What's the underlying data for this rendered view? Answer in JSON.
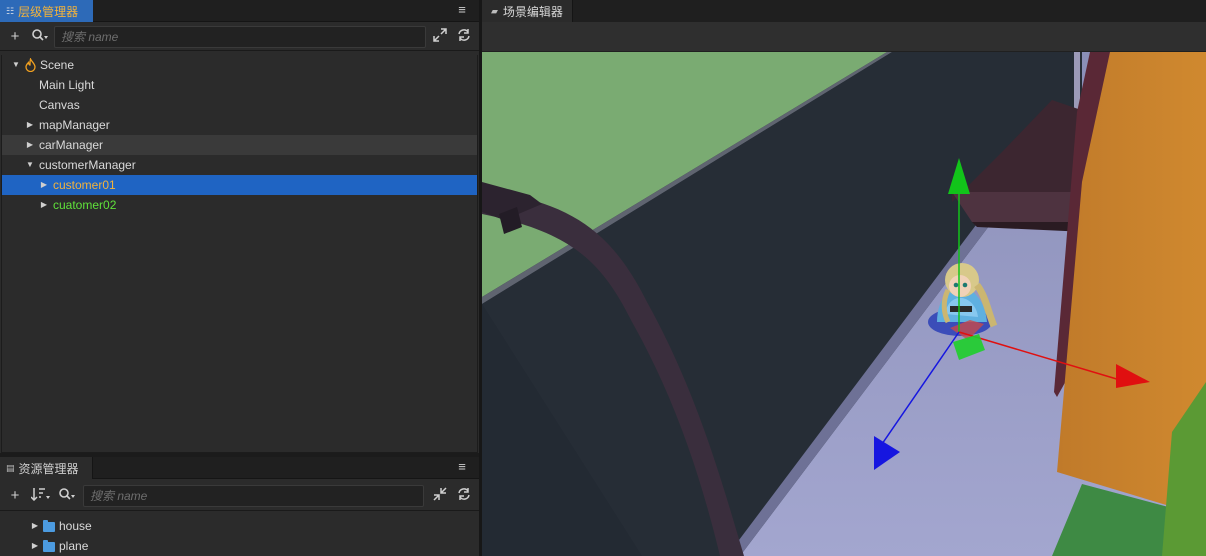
{
  "hierarchy_panel": {
    "tab_label": "层级管理器",
    "search_placeholder": "搜索 name",
    "tree": [
      {
        "label": "Scene",
        "depth": 0,
        "expanded": true,
        "has_children": true,
        "state": "normal"
      },
      {
        "label": "Main Light",
        "depth": 1,
        "has_children": false,
        "state": "normal"
      },
      {
        "label": "Canvas",
        "depth": 1,
        "has_children": false,
        "state": "normal"
      },
      {
        "label": "mapManager",
        "depth": 1,
        "expanded": false,
        "has_children": true,
        "state": "normal"
      },
      {
        "label": "carManager",
        "depth": 1,
        "expanded": false,
        "has_children": true,
        "state": "hover"
      },
      {
        "label": "customerManager",
        "depth": 1,
        "expanded": true,
        "has_children": true,
        "state": "normal"
      },
      {
        "label": "customer01",
        "depth": 2,
        "expanded": false,
        "has_children": true,
        "state": "selected"
      },
      {
        "label": "cuatomer02",
        "depth": 2,
        "expanded": false,
        "has_children": true,
        "state": "normal"
      }
    ]
  },
  "assets_panel": {
    "tab_label": "资源管理器",
    "search_placeholder": "搜索 name",
    "tree": [
      {
        "label": "house",
        "type": "folder"
      },
      {
        "label": "plane",
        "type": "folder"
      }
    ]
  },
  "scene_panel": {
    "tab_label": "场景编辑器"
  },
  "colors": {
    "selected_row": "#1f64c3",
    "selected_text": "#f2b33c",
    "prefab_text": "#5fe23a",
    "active_tab": "#2d6ab8",
    "gizmo_x": "#e01010",
    "gizmo_y": "#12c41a",
    "gizmo_z": "#1616e0"
  },
  "icons": {
    "add": "plus-icon",
    "search": "search-icon",
    "sort": "sort-icon",
    "expand_all": "expand-icon",
    "collapse_all": "collapse-icon",
    "refresh": "refresh-icon",
    "menu": "menu-icon",
    "scene": "flame-icon",
    "folder": "folder-icon"
  }
}
